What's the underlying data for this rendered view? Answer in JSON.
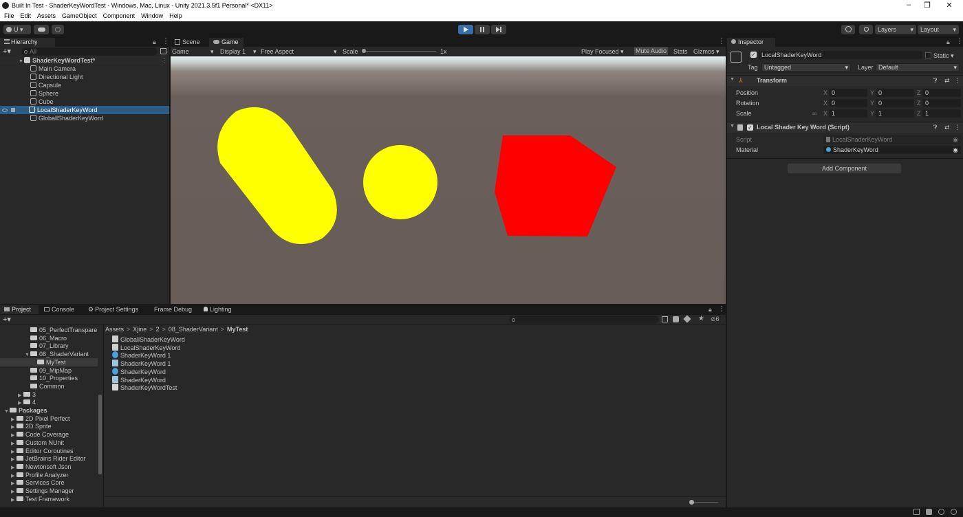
{
  "window": {
    "title": "Built In Test - ShaderKeyWordTest - Windows, Mac, Linux - Unity 2021.3.5f1 Personal* <DX11>",
    "minimize": "–",
    "maximize": "❐",
    "close": "✕"
  },
  "menu": [
    "File",
    "Edit",
    "Assets",
    "GameObject",
    "Component",
    "Window",
    "Help"
  ],
  "toolbar": {
    "account": "U",
    "layers": "Layers",
    "layout": "Layout"
  },
  "hierarchy": {
    "tab": "Hierarchy",
    "search_placeholder": "All",
    "scene": "ShaderKeyWordTest*",
    "items": [
      "Main Camera",
      "Directional Light",
      "Capsule",
      "Sphere",
      "Cube",
      "LocalShaderKeyWord",
      "GloballShaderKeyWord"
    ],
    "selected_index": 5
  },
  "game": {
    "tabs": [
      "Scene",
      "Game"
    ],
    "active_tab": "Game",
    "mode": "Game",
    "display": "Display 1",
    "aspect": "Free Aspect",
    "scale_label": "Scale",
    "scale_value": "1x",
    "play_focused": "Play Focused",
    "mute_audio": "Mute Audio",
    "stats": "Stats",
    "gizmos": "Gizmos",
    "colors": {
      "capsule": "#ffff00",
      "sphere": "#ffff00",
      "cube": "#ff0000",
      "ground": "#685d58",
      "sky": "#d8eeee"
    }
  },
  "inspector": {
    "tab": "Inspector",
    "object_name": "LocalShaderKeyWord",
    "static_label": "Static",
    "tag_label": "Tag",
    "tag_value": "Untagged",
    "layer_label": "Layer",
    "layer_value": "Default",
    "transform": {
      "title": "Transform",
      "position_label": "Position",
      "rotation_label": "Rotation",
      "scale_label": "Scale",
      "position": [
        "0",
        "0",
        "0"
      ],
      "rotation": [
        "0",
        "0",
        "0"
      ],
      "scale": [
        "1",
        "1",
        "1"
      ],
      "x": "X",
      "y": "Y",
      "z": "Z"
    },
    "script_component": {
      "title": "Local Shader Key Word (Script)",
      "script_label": "Script",
      "script_value": "LocalShaderKeyWord",
      "material_label": "Material",
      "material_value": "ShaderKeyWord"
    },
    "add_component": "Add Component"
  },
  "project": {
    "tabs": [
      "Project",
      "Console",
      "Project Settings",
      "Frame Debug",
      "Lighting"
    ],
    "tree": [
      {
        "label": "05_PerfectTranspare",
        "indent": 3,
        "type": "folder"
      },
      {
        "label": "06_Macro",
        "indent": 3,
        "type": "folder"
      },
      {
        "label": "07_Library",
        "indent": 3,
        "type": "folder"
      },
      {
        "label": "08_ShaderVariant",
        "indent": 3,
        "type": "folder-open"
      },
      {
        "label": "MyTest",
        "indent": 4,
        "type": "folder",
        "selected": true
      },
      {
        "label": "09_MipMap",
        "indent": 3,
        "type": "folder"
      },
      {
        "label": "10_Properties",
        "indent": 3,
        "type": "folder"
      },
      {
        "label": "Common",
        "indent": 3,
        "type": "folder"
      },
      {
        "label": "3",
        "indent": 2,
        "type": "folder-closed"
      },
      {
        "label": "4",
        "indent": 2,
        "type": "folder-closed"
      },
      {
        "label": "Packages",
        "indent": 0,
        "type": "folder-open"
      },
      {
        "label": "2D Pixel Perfect",
        "indent": 1,
        "type": "folder-closed"
      },
      {
        "label": "2D Sprite",
        "indent": 1,
        "type": "folder-closed"
      },
      {
        "label": "Code Coverage",
        "indent": 1,
        "type": "folder-closed"
      },
      {
        "label": "Custom NUnit",
        "indent": 1,
        "type": "folder-closed"
      },
      {
        "label": "Editor Coroutines",
        "indent": 1,
        "type": "folder-closed"
      },
      {
        "label": "JetBrains Rider Editor",
        "indent": 1,
        "type": "folder-closed"
      },
      {
        "label": "Newtonsoft Json",
        "indent": 1,
        "type": "folder-closed"
      },
      {
        "label": "Profile Analyzer",
        "indent": 1,
        "type": "folder-closed"
      },
      {
        "label": "Services Core",
        "indent": 1,
        "type": "folder-closed"
      },
      {
        "label": "Settings Manager",
        "indent": 1,
        "type": "folder-closed"
      },
      {
        "label": "Test Framework",
        "indent": 1,
        "type": "folder-closed"
      }
    ],
    "breadcrumb": [
      "Assets",
      "Xjine",
      "2",
      "08_ShaderVariant",
      "MyTest"
    ],
    "files": [
      {
        "label": "GloballShaderKeyWord",
        "kind": "script"
      },
      {
        "label": "LocalShaderKeyWord",
        "kind": "script"
      },
      {
        "label": "ShaderKeyWord 1",
        "kind": "material"
      },
      {
        "label": "ShaderKeyWord 1",
        "kind": "shader"
      },
      {
        "label": "ShaderKeyWord",
        "kind": "material"
      },
      {
        "label": "ShaderKeyWord",
        "kind": "shader"
      },
      {
        "label": "ShaderKeyWordTest",
        "kind": "scene"
      }
    ],
    "hidden_count": "6"
  }
}
